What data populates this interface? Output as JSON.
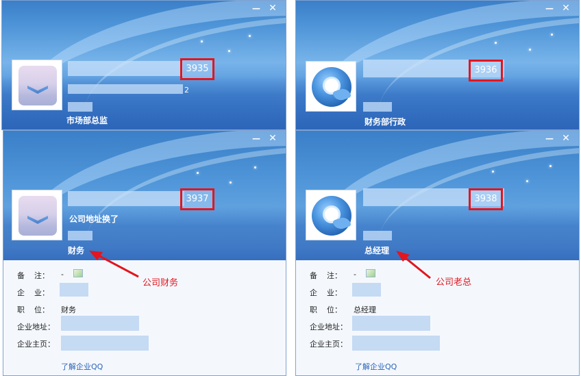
{
  "window_controls": {
    "minimize": "—",
    "close": "✕"
  },
  "cards": [
    {
      "id": "3935",
      "signature": "",
      "signature_suffix": "2",
      "role": "市场部总监"
    },
    {
      "id": "3936",
      "signature": "",
      "signature_suffix": "",
      "role": "财务部行政"
    },
    {
      "id": "3937",
      "signature": "公司地址换了",
      "signature_suffix": "",
      "role": "财务"
    },
    {
      "id": "3938",
      "signature": "",
      "signature_suffix": "",
      "role": "总经理"
    }
  ],
  "details": [
    {
      "note_label": "备    注：",
      "note_value": "-",
      "company_label": "企    业：",
      "position_label": "职    位：",
      "position_value": "财务",
      "address_label": "企业地址：",
      "homepage_label": "企业主页：",
      "learn_link": "了解企业QQ"
    },
    {
      "note_label": "备    注：",
      "note_value": "-",
      "company_label": "企    业：",
      "position_label": "职    位：",
      "position_value": "总经理",
      "address_label": "企业地址：",
      "homepage_label": "企业主页：",
      "learn_link": "了解企业QQ"
    }
  ],
  "annotations": {
    "left": "公司财务",
    "right": "公司老总"
  },
  "colors": {
    "highlight_red": "#e3151e",
    "header_blue": "#4f95d8",
    "link_blue": "#2a62b8"
  }
}
